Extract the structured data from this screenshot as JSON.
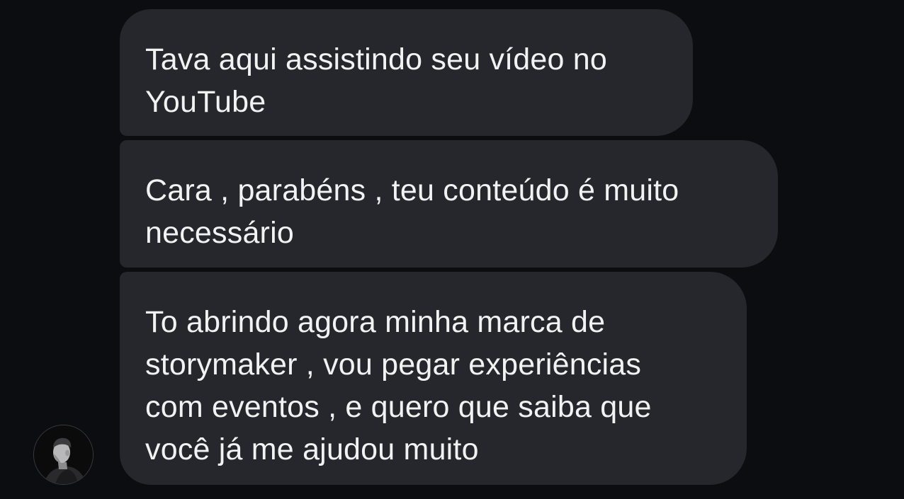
{
  "messages": [
    {
      "text": "Tava aqui assistindo seu vídeo no\nYouTube"
    },
    {
      "text": "Cara , parabéns , teu conteúdo é muito\nnecessário"
    },
    {
      "text": "To abrindo agora minha marca de\nstorymaker , vou pegar experiências\ncom eventos , e quero que saiba que\nvocê já me ajudou muito"
    }
  ],
  "sender": {
    "avatar_icon": "user-profile-photo"
  },
  "colors": {
    "background": "#0c0d11",
    "bubble": "#25272c",
    "text": "#f2f2f3"
  }
}
